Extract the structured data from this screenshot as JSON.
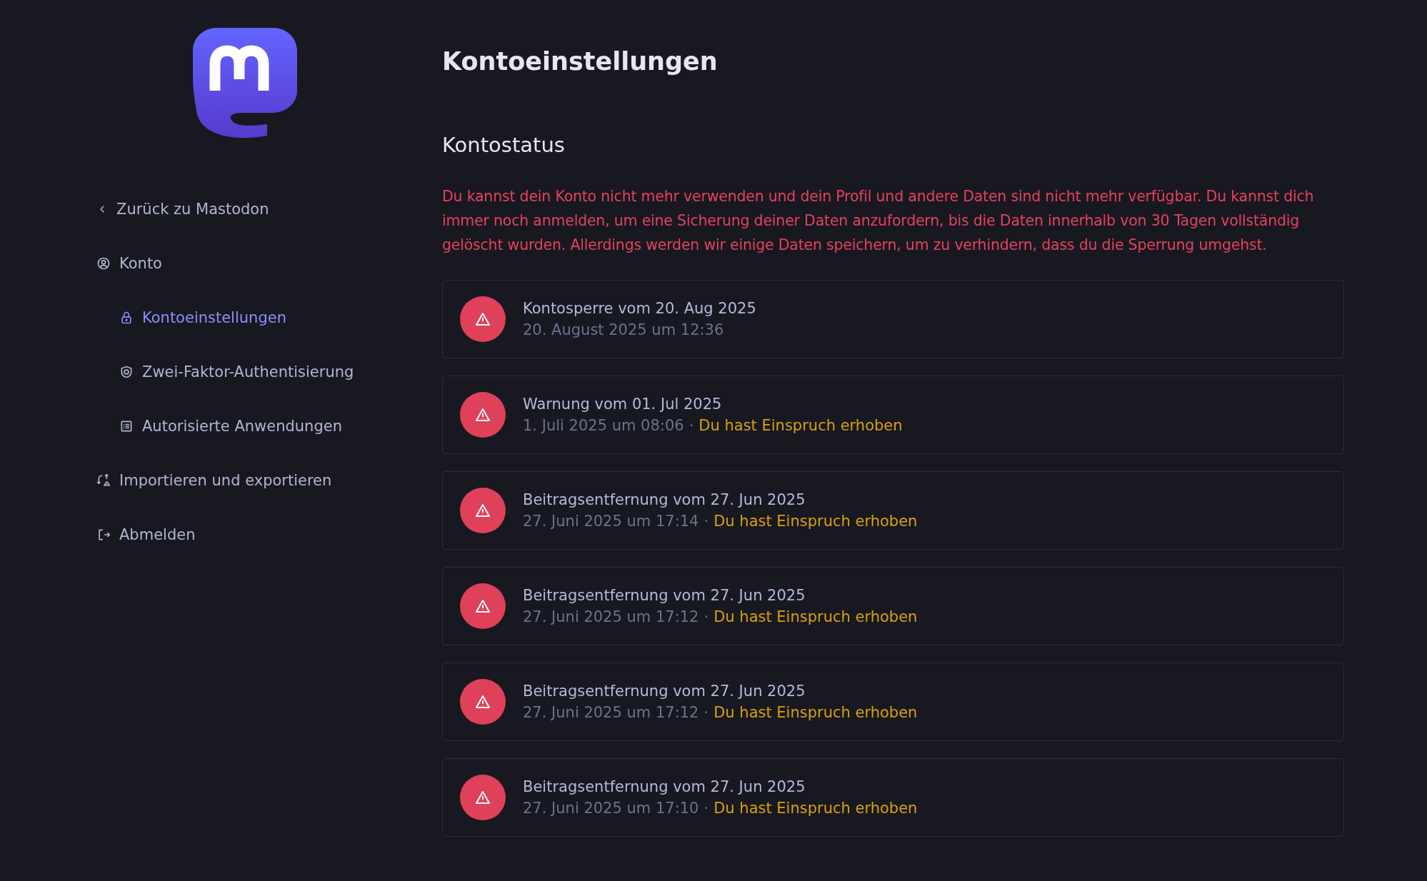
{
  "sidebar": {
    "back_link": "Zurück zu Mastodon",
    "items": [
      {
        "label": "Konto",
        "selected": false,
        "children": [
          {
            "label": "Kontoeinstellungen",
            "selected": true
          },
          {
            "label": "Zwei-Faktor-Authentisierung",
            "selected": false
          },
          {
            "label": "Autorisierte Anwendungen",
            "selected": false
          }
        ]
      },
      {
        "label": "Importieren und exportieren",
        "selected": false
      },
      {
        "label": "Abmelden",
        "selected": false
      }
    ]
  },
  "page": {
    "title": "Kontoeinstellungen",
    "section_title": "Kontostatus",
    "notice": "Du kannst dein Konto nicht mehr verwenden und dein Profil und andere Daten sind nicht mehr verfügbar. Du kannst dich immer noch anmelden, um eine Sicherung deiner Daten anzufordern, bis die Daten innerhalb von 30 Tagen vollständig gelöscht wurden. Allerdings werden wir einige Daten speichern, um zu verhindern, dass du die Sperrung umgehst.",
    "strikes": [
      {
        "title": "Kontosperre vom 20. Aug 2025",
        "date": "20. August 2025 um 12:36"
      },
      {
        "title": "Warnung vom 01. Jul 2025",
        "date": "1. Juli 2025 um 08:06",
        "separator": "·",
        "appeal": "Du hast Einspruch erhoben"
      },
      {
        "title": "Beitragsentfernung vom 27. Jun 2025",
        "date": "27. Juni 2025 um 17:14",
        "separator": "·",
        "appeal": "Du hast Einspruch erhoben"
      },
      {
        "title": "Beitragsentfernung vom 27. Jun 2025",
        "date": "27. Juni 2025 um 17:12",
        "separator": "·",
        "appeal": "Du hast Einspruch erhoben"
      },
      {
        "title": "Beitragsentfernung vom 27. Jun 2025",
        "date": "27. Juni 2025 um 17:12",
        "separator": "·",
        "appeal": "Du hast Einspruch erhoben"
      },
      {
        "title": "Beitragsentfernung vom 27. Jun 2025",
        "date": "27. Juni 2025 um 17:10",
        "separator": "·",
        "appeal": "Du hast Einspruch erhoben"
      }
    ]
  }
}
